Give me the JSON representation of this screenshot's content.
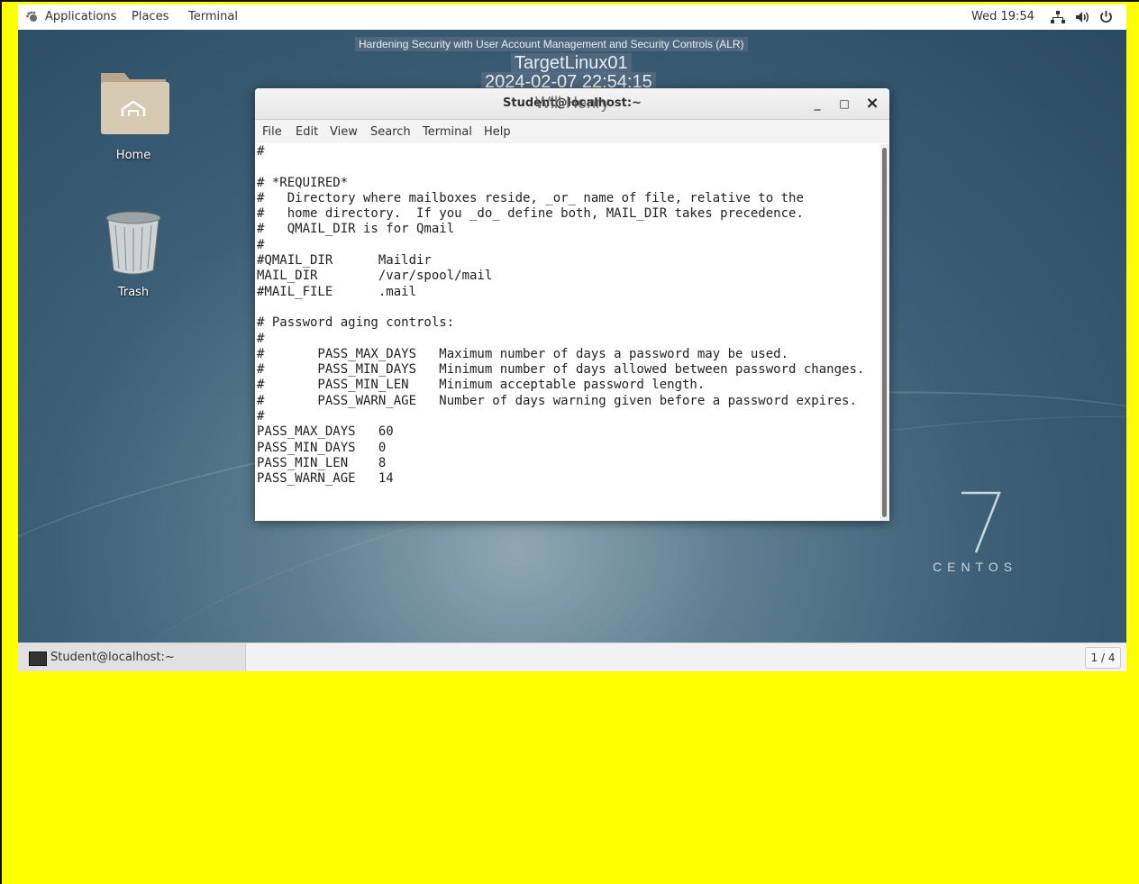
{
  "topbar": {
    "applications": "Applications",
    "places": "Places",
    "terminal": "Terminal",
    "clock": "Wed 19:54"
  },
  "icons": {
    "apps": "gnome-foot-icon",
    "network": "network-icon",
    "volume": "volume-icon",
    "power": "power-icon"
  },
  "desktop": {
    "home_label": "Home",
    "trash_label": "Trash"
  },
  "watermark": {
    "lab_title": "Hardening Security with User Account Management and Security Controls (ALR)",
    "host": "TargetLinux01",
    "timestamp": "2024-02-07 22:54:15",
    "user": "Will Henry"
  },
  "window": {
    "title": "Student@localhost:~",
    "menu": [
      "File",
      "Edit",
      "View",
      "Search",
      "Terminal",
      "Help"
    ],
    "minimize": "_",
    "maximize": "□",
    "close": "×"
  },
  "terminal_lines": [
    "#",
    "",
    "# *REQUIRED*",
    "#   Directory where mailboxes reside, _or_ name of file, relative to the",
    "#   home directory.  If you _do_ define both, MAIL_DIR takes precedence.",
    "#   QMAIL_DIR is for Qmail",
    "#",
    "#QMAIL_DIR      Maildir",
    "MAIL_DIR        /var/spool/mail",
    "#MAIL_FILE      .mail",
    "",
    "# Password aging controls:",
    "#",
    "#       PASS_MAX_DAYS   Maximum number of days a password may be used.",
    "#       PASS_MIN_DAYS   Minimum number of days allowed between password changes.",
    "#       PASS_MIN_LEN    Minimum acceptable password length.",
    "#       PASS_WARN_AGE   Number of days warning given before a password expires.",
    "#",
    "PASS_MAX_DAYS   60",
    "PASS_MIN_DAYS   0",
    "PASS_MIN_LEN    8",
    "PASS_WARN_AGE   14"
  ],
  "branding": {
    "version": "7",
    "name": "CENTOS"
  },
  "taskbar": {
    "window_label": "Student@localhost:~",
    "workspace": "1 / 4"
  }
}
